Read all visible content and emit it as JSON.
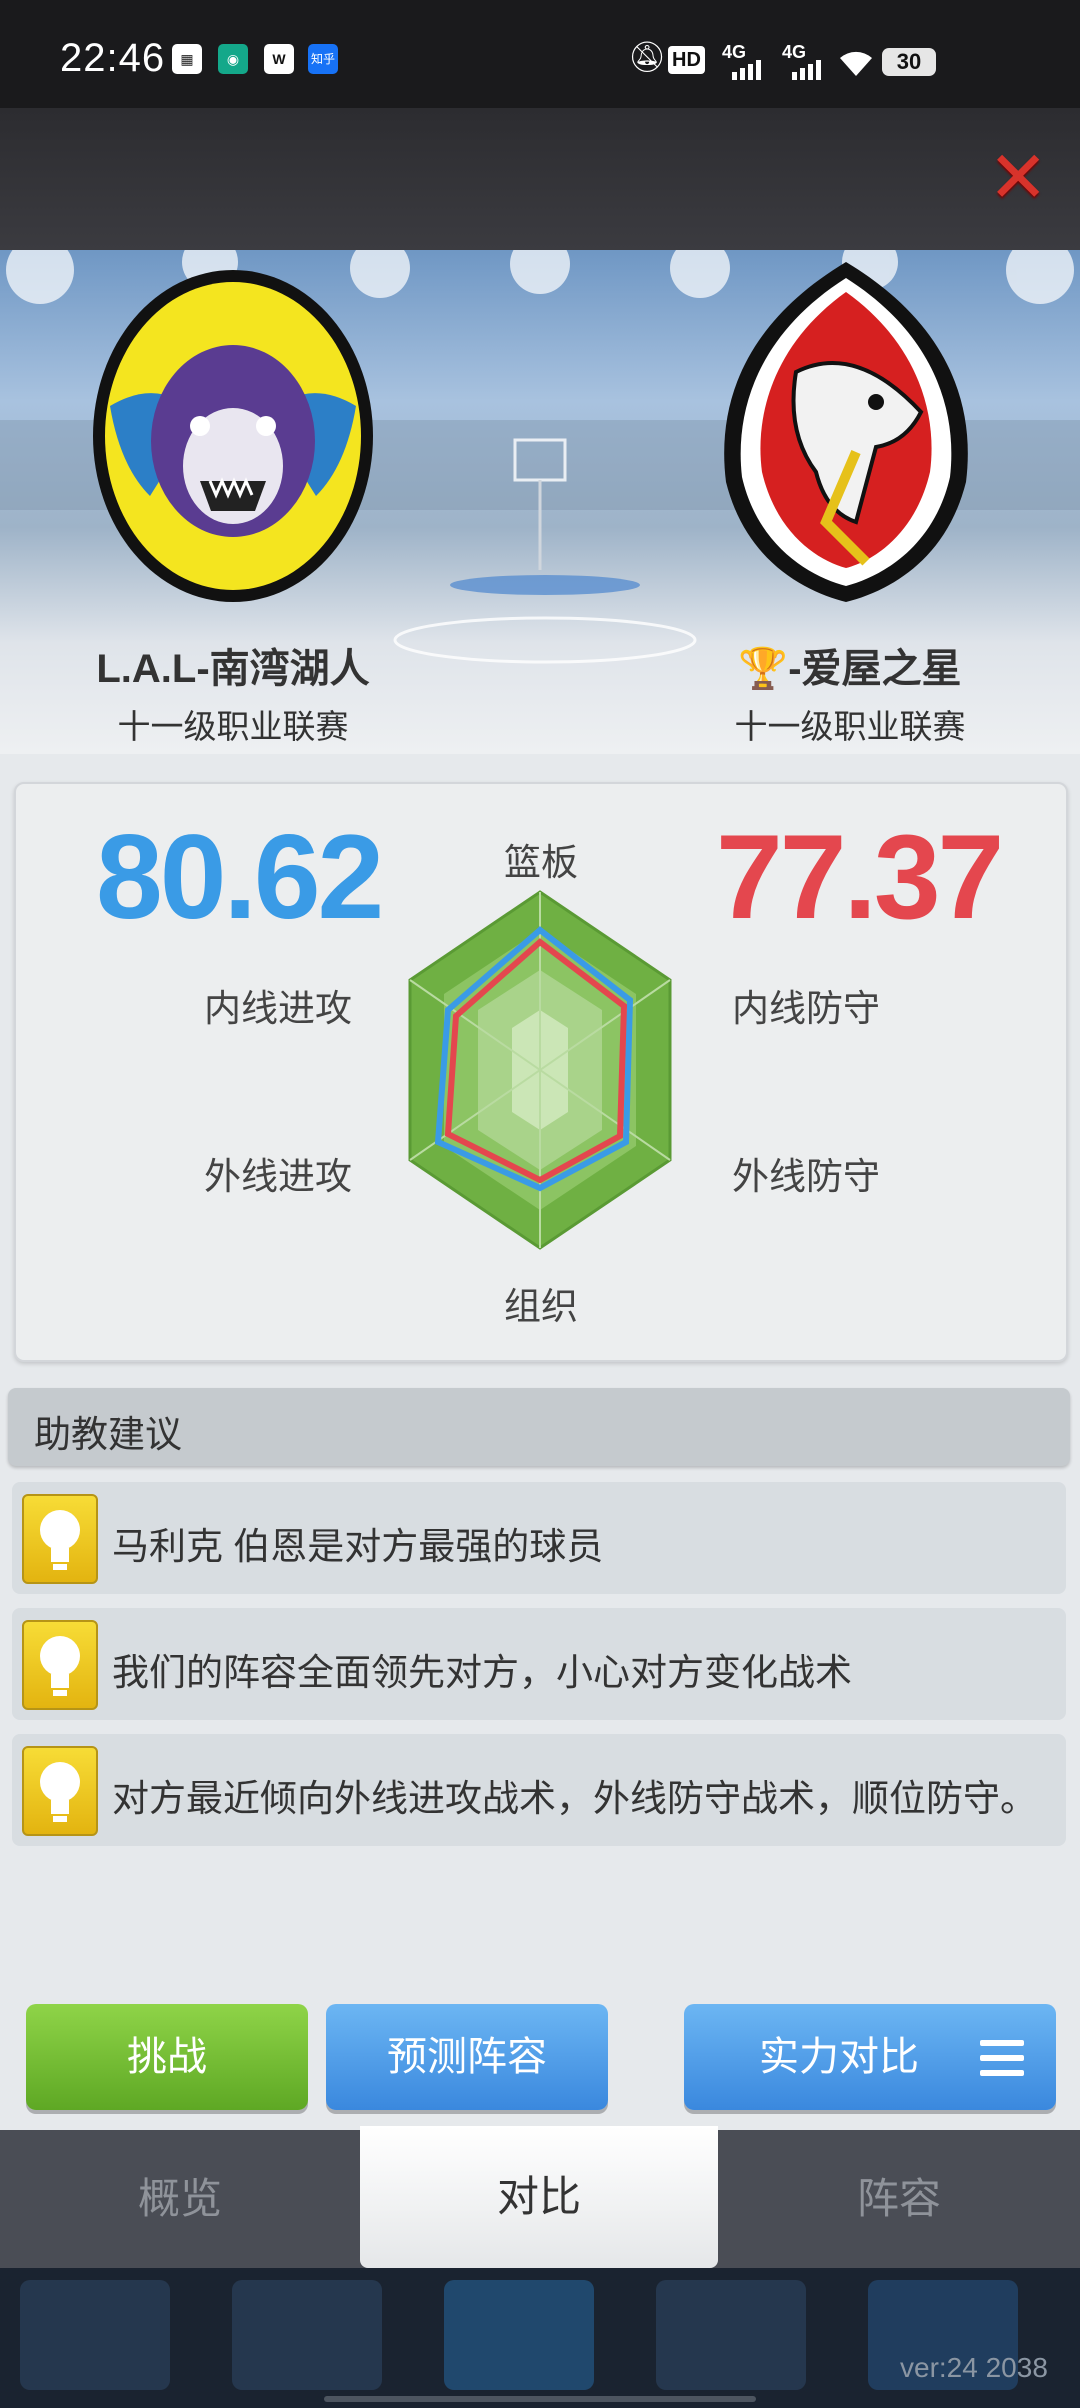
{
  "status_bar": {
    "time": "22:46",
    "apps": [
      "grid-app-icon",
      "wechat-shield-icon",
      "w-app-icon",
      "zhihu-icon"
    ],
    "zhihu_label": "知乎",
    "hd_label": "HD",
    "net1": "4G",
    "net2": "4G",
    "battery": "30"
  },
  "header": {
    "close_icon": "close-x-icon"
  },
  "match": {
    "home": {
      "name": "L.A.L-南湾湖人",
      "league": "十一级职业联赛",
      "logo": "tiger-basketball-logo"
    },
    "away": {
      "trophy": "🏆",
      "name": "-爱屋之星",
      "league": "十一级职业联赛",
      "logo": "dragon-logo"
    }
  },
  "comparison": {
    "home_score": "80.62",
    "away_score": "77.37",
    "home_color": "#3a9be6",
    "away_color": "#e4474e",
    "labels": {
      "top": "篮板",
      "upper_left": "内线进攻",
      "upper_right": "内线防守",
      "lower_left": "外线进攻",
      "lower_right": "外线防守",
      "bottom": "组织"
    }
  },
  "advice": {
    "title": "助教建议",
    "tips": [
      "马利克 伯恩是对方最强的球员",
      "我们的阵容全面领先对方，小心对方变化战术",
      "对方最近倾向外线进攻战术，外线防守战术，顺位防守。"
    ]
  },
  "buttons": {
    "challenge": "挑战",
    "predict": "预测阵容",
    "compare": "实力对比"
  },
  "tabs": [
    "概览",
    "对比",
    "阵容"
  ],
  "footer": {
    "version": "ver:24  2038"
  }
}
